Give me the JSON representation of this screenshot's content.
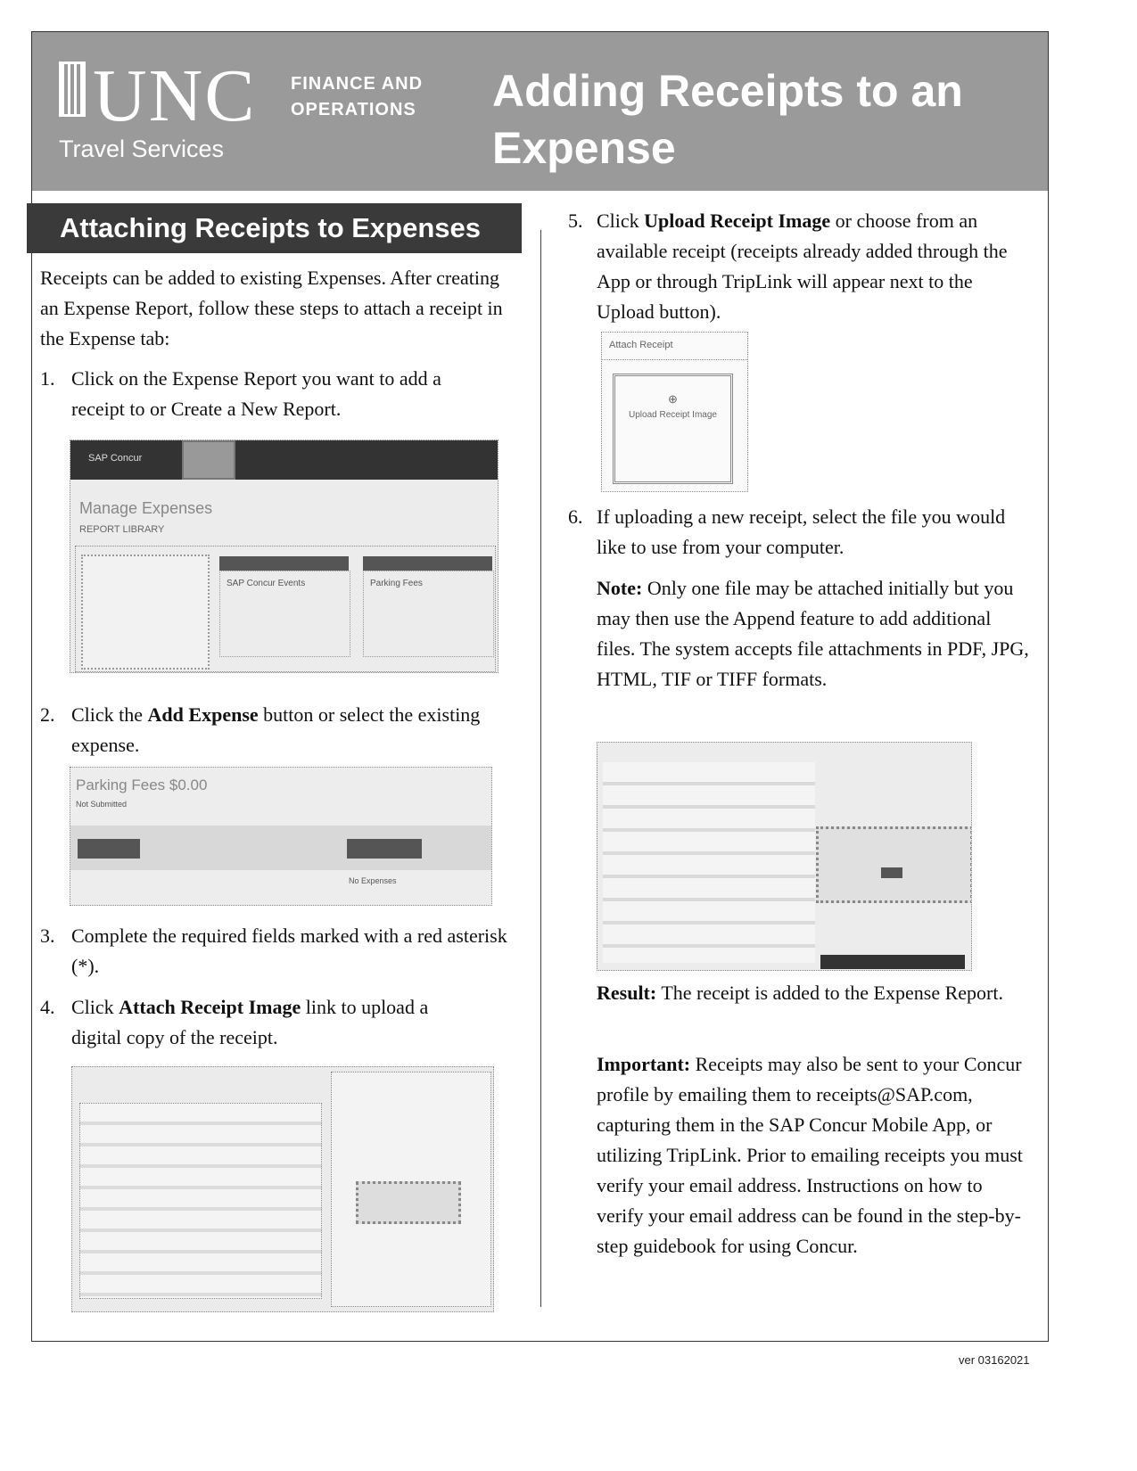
{
  "header": {
    "logo_text": "UNC",
    "dept_line1": "FINANCE AND",
    "dept_line2": "OPERATIONS",
    "unit": "Travel Services",
    "title": "Adding Receipts to an Expense"
  },
  "section_title": "Attaching Receipts to Expenses",
  "intro": "Receipts can be added to existing Expenses. After creating an Expense Report, follow these steps to attach a receipt in the Expense tab:",
  "steps": [
    {
      "num": "1.",
      "pre": "Click on the Expense Report you want to add a receipt to or Create a New Report.",
      "bold": "",
      "post": ""
    },
    {
      "num": "2.",
      "pre": "Click the ",
      "bold": "Add Expense",
      "post": " button or select the existing expense."
    },
    {
      "num": "3.",
      "pre": "Complete the required fields marked with a red asterisk (*).",
      "bold": "",
      "post": ""
    },
    {
      "num": "4.",
      "pre": "Click ",
      "bold": "Attach Receipt Image",
      "post": " link to upload a digital copy of the receipt."
    },
    {
      "num": "5.",
      "pre": "Click ",
      "bold": "Upload Receipt Image",
      "post": " or choose from an available receipt (receipts already added through the App or through TripLink will appear next to the Upload button)."
    },
    {
      "num": "6.",
      "pre": "If uploading a new receipt, select the file you would like to use from your computer.",
      "bold": "",
      "post": ""
    }
  ],
  "note": {
    "label": "Note:",
    "text": " Only one file may be attached initially but you may then use the Append feature to add additional files.  The system accepts file attachments in PDF, JPG, HTML, TIF or TIFF formats."
  },
  "result": {
    "label": "Result:",
    "text": " The receipt is added to the Expense Report."
  },
  "important": {
    "label": "Important:",
    "text": " Receipts may also be sent to your Concur profile by emailing them to receipts@SAP.com, capturing them in the SAP Concur Mobile App, or utilizing TripLink. Prior to emailing receipts you must verify your email address. Instructions on how to verify your email address can be found in the step-by-step guidebook for using Concur."
  },
  "screenshots": {
    "manage": {
      "brand": "SAP Concur",
      "heading": "Manage Expenses",
      "library": "REPORT LIBRARY",
      "card1": "SAP Concur Events",
      "card2": "Parking Fees"
    },
    "expense": {
      "heading": "Parking Fees $0.00",
      "status": "Not Submitted",
      "empty": "No Expenses"
    },
    "attach": {
      "heading": "Attach Receipt",
      "button": "Upload Receipt Image"
    }
  },
  "version": "ver 03162021"
}
